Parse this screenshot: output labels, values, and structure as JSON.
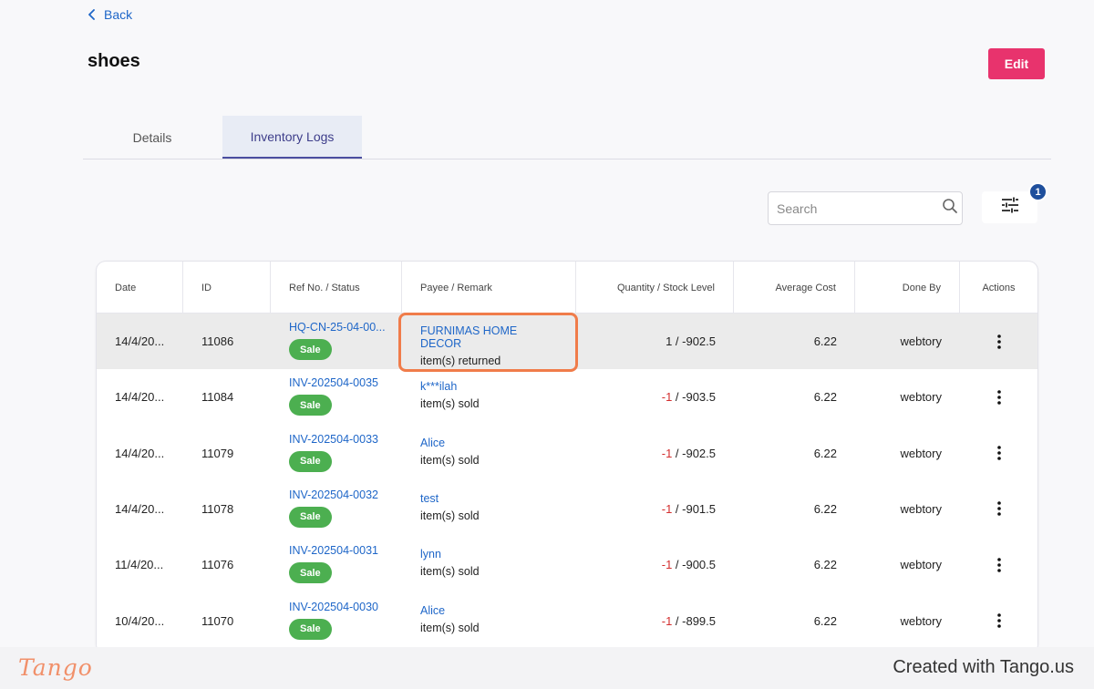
{
  "nav": {
    "back_label": "Back"
  },
  "page": {
    "title": "shoes",
    "edit_label": "Edit"
  },
  "tabs": [
    {
      "label": "Details",
      "active": false
    },
    {
      "label": "Inventory Logs",
      "active": true
    }
  ],
  "search": {
    "placeholder": "Search",
    "value": ""
  },
  "filter": {
    "badge_count": "1"
  },
  "colors": {
    "accent": "#e8336d",
    "link": "#1e66c8",
    "sale": "#4caf50",
    "negative": "#d32f2f",
    "highlight": "#f07c4a"
  },
  "table": {
    "headers": [
      "Date",
      "ID",
      "Ref No. / Status",
      "Payee / Remark",
      "Quantity / Stock Level",
      "Average Cost",
      "Done By",
      "Actions"
    ],
    "rows": [
      {
        "date": "14/4/20...",
        "id": "11086",
        "ref": "HQ-CN-25-04-00...",
        "status": "Sale",
        "payee": "FURNIMAS HOME DECOR",
        "remark": "item(s) returned",
        "qty": "1",
        "stock": " / -902.5",
        "cost": "6.22",
        "done_by": "webtory"
      },
      {
        "date": "14/4/20...",
        "id": "11084",
        "ref": "INV-202504-0035",
        "status": "Sale",
        "payee": "k***ilah",
        "remark": "item(s) sold",
        "qty": "-1",
        "stock": " / -903.5",
        "cost": "6.22",
        "done_by": "webtory"
      },
      {
        "date": "14/4/20...",
        "id": "11079",
        "ref": "INV-202504-0033",
        "status": "Sale",
        "payee": "Alice",
        "remark": "item(s) sold",
        "qty": "-1",
        "stock": " / -902.5",
        "cost": "6.22",
        "done_by": "webtory"
      },
      {
        "date": "14/4/20...",
        "id": "11078",
        "ref": "INV-202504-0032",
        "status": "Sale",
        "payee": "test",
        "remark": "item(s) sold",
        "qty": "-1",
        "stock": " / -901.5",
        "cost": "6.22",
        "done_by": "webtory"
      },
      {
        "date": "11/4/20...",
        "id": "11076",
        "ref": "INV-202504-0031",
        "status": "Sale",
        "payee": "lynn",
        "remark": "item(s) sold",
        "qty": "-1",
        "stock": " / -900.5",
        "cost": "6.22",
        "done_by": "webtory"
      },
      {
        "date": "10/4/20...",
        "id": "11070",
        "ref": "INV-202504-0030",
        "status": "Sale",
        "payee": "Alice",
        "remark": "item(s) sold",
        "qty": "-1",
        "stock": " / -899.5",
        "cost": "6.22",
        "done_by": "webtory"
      }
    ]
  },
  "footer": {
    "logo_text": "Tango",
    "created_text": "Created with Tango.us"
  }
}
